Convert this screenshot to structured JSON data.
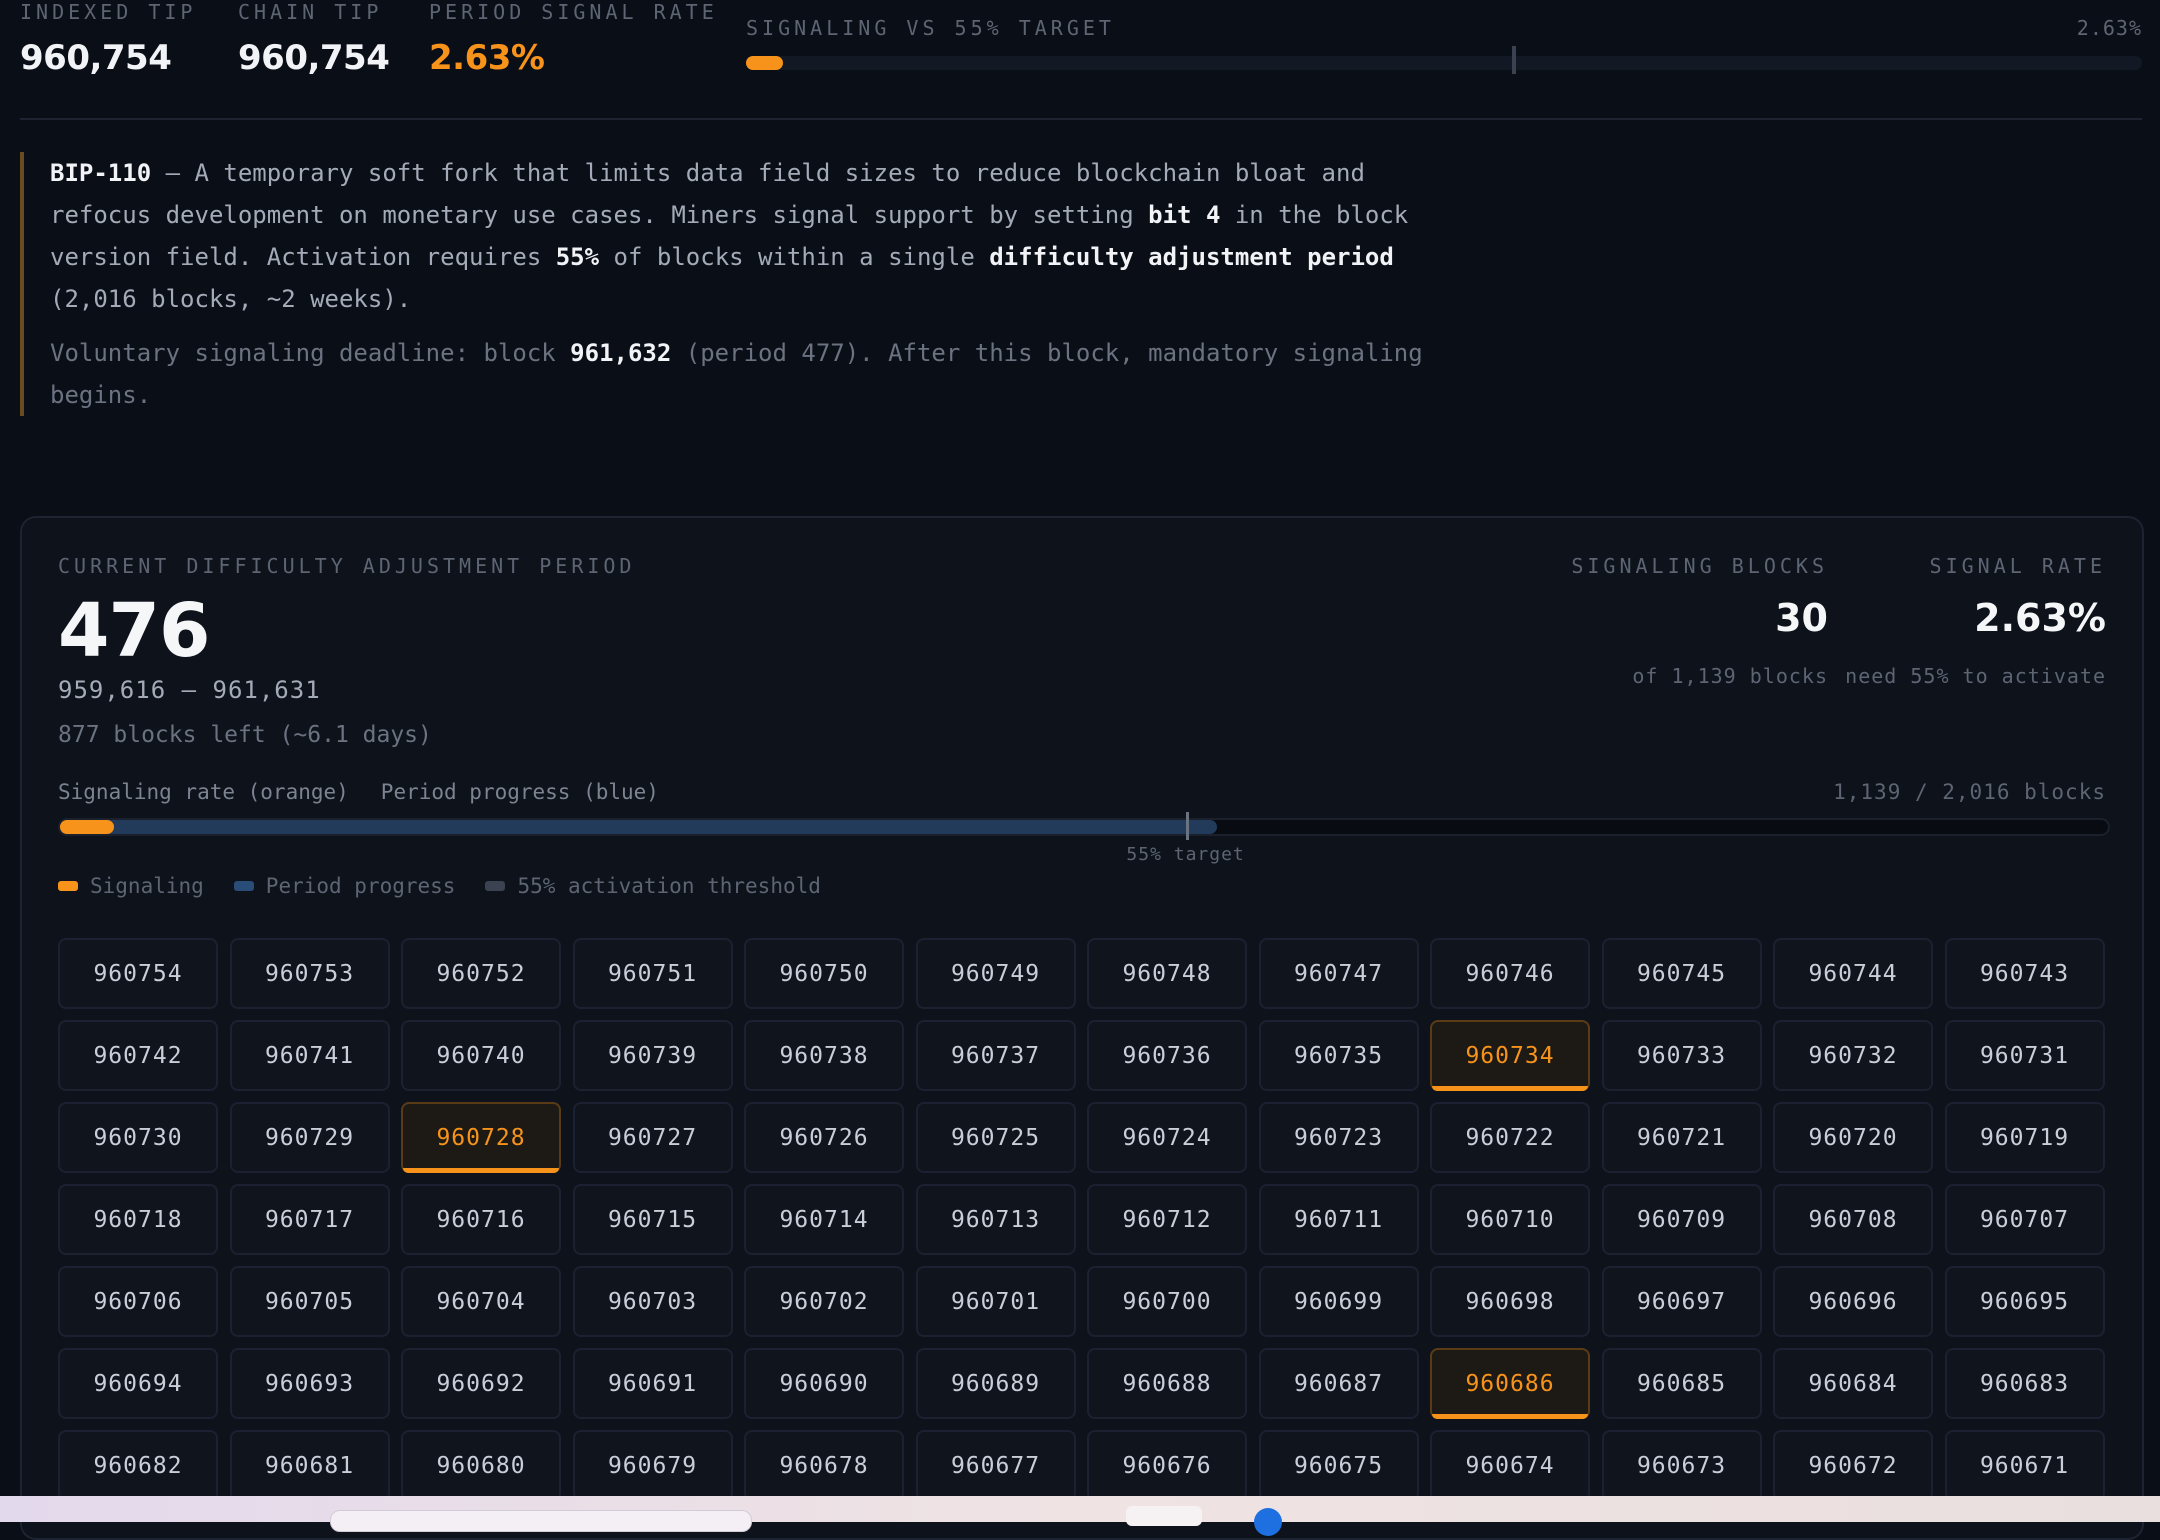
{
  "top": {
    "indexed_tip_label": "INDEXED TIP",
    "indexed_tip": "960,754",
    "chain_tip_label": "CHAIN TIP",
    "chain_tip": "960,754",
    "period_rate_label": "PERIOD SIGNAL RATE",
    "period_rate": "2.63%",
    "signaling_label": "SIGNALING VS 55% TARGET",
    "signaling_pct": "2.63%",
    "signaling_fraction": 0.0263,
    "target_fraction": 0.55
  },
  "info": {
    "bip": "BIP-110",
    "text1": " — A temporary soft fork that limits data field sizes to reduce blockchain bloat and refocus development on monetary use cases. Miners signal support by setting ",
    "bit": "bit 4",
    "text2": " in the block version field. Activation requires ",
    "pct": "55%",
    "text3": " of blocks within a single ",
    "dap": "difficulty adjustment period",
    "text4": " (2,016 blocks, ~2 weeks).",
    "deadline_pre": "Voluntary signaling deadline: block ",
    "deadline_block": "961,632",
    "deadline_post": " (period 477). After this block, mandatory signaling begins."
  },
  "period": {
    "label": "CURRENT DIFFICULTY ADJUSTMENT PERIOD",
    "number": "476",
    "range": "959,616 – 961,631",
    "left": "877 blocks left (~6.1 days)",
    "signaling_blocks_label": "SIGNALING BLOCKS",
    "signaling_blocks": "30",
    "signaling_blocks_sub": "of 1,139 blocks",
    "signal_rate_label": "SIGNAL RATE",
    "signal_rate": "2.63%",
    "signal_rate_sub": "need 55% to activate",
    "bar_label_signal": "Signaling rate (orange)",
    "bar_label_progress": "Period progress (blue)",
    "blocks_count": "1,139 / 2,016 blocks",
    "target_label": "55% target",
    "progress_fraction": 0.565,
    "signal_fraction": 0.0263,
    "target_fraction": 0.55
  },
  "legend": {
    "signaling": "Signaling",
    "progress": "Period progress",
    "threshold": "55% activation threshold",
    "colors": {
      "signaling": "#f7931a",
      "progress": "#2a4d78",
      "threshold": "#3b4352"
    }
  },
  "blocks": [
    "960754",
    "960753",
    "960752",
    "960751",
    "960750",
    "960749",
    "960748",
    "960747",
    "960746",
    "960745",
    "960744",
    "960743",
    "960742",
    "960741",
    "960740",
    "960739",
    "960738",
    "960737",
    "960736",
    "960735",
    "960734",
    "960733",
    "960732",
    "960731",
    "960730",
    "960729",
    "960728",
    "960727",
    "960726",
    "960725",
    "960724",
    "960723",
    "960722",
    "960721",
    "960720",
    "960719",
    "960718",
    "960717",
    "960716",
    "960715",
    "960714",
    "960713",
    "960712",
    "960711",
    "960710",
    "960709",
    "960708",
    "960707",
    "960706",
    "960705",
    "960704",
    "960703",
    "960702",
    "960701",
    "960700",
    "960699",
    "960698",
    "960697",
    "960696",
    "960695",
    "960694",
    "960693",
    "960692",
    "960691",
    "960690",
    "960689",
    "960688",
    "960687",
    "960686",
    "960685",
    "960684",
    "960683",
    "960682",
    "960681",
    "960680",
    "960679",
    "960678",
    "960677",
    "960676",
    "960675",
    "960674",
    "960673",
    "960672",
    "960671"
  ],
  "signaling_blocks": [
    "960734",
    "960728",
    "960686"
  ]
}
